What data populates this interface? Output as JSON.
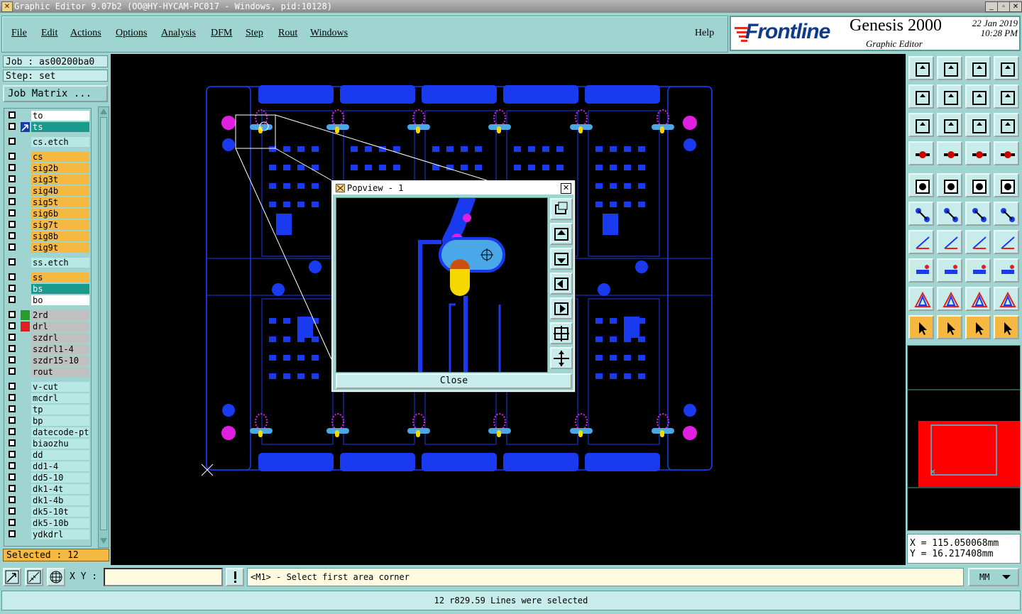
{
  "window": {
    "title": "Graphic Editor 9.07b2 (OO@HY-HYCAM-PC017 - Windows, pid:10128)"
  },
  "menu": [
    "File",
    "Edit",
    "Actions",
    "Options",
    "Analysis",
    "DFM",
    "Step",
    "Rout",
    "Windows"
  ],
  "help_label": "Help",
  "brand": {
    "logo": "Frontline",
    "product": "Genesis 2000",
    "subtitle": "Graphic Editor",
    "date": "22 Jan 2019",
    "time": "10:28 PM"
  },
  "job": {
    "job_label": "Job : as00200ba0",
    "step_label": "Step: set",
    "matrix_button": "Job Matrix ..."
  },
  "layers": [
    {
      "name": "to",
      "bg": "#ffffff",
      "swatch": ""
    },
    {
      "name": "ts",
      "bg": "#1a9a8c",
      "swatch": "#1a3ab0",
      "active": true
    },
    {
      "name": "cs.etch",
      "bg": "#b8e8e4",
      "swatch": "",
      "gap": true
    },
    {
      "name": "cs",
      "bg": "#f5b840",
      "swatch": "",
      "gap": true
    },
    {
      "name": "sig2b",
      "bg": "#f5b840",
      "swatch": ""
    },
    {
      "name": "sig3t",
      "bg": "#f5b840",
      "swatch": ""
    },
    {
      "name": "sig4b",
      "bg": "#f5b840",
      "swatch": ""
    },
    {
      "name": "sig5t",
      "bg": "#f5b840",
      "swatch": ""
    },
    {
      "name": "sig6b",
      "bg": "#f5b840",
      "swatch": ""
    },
    {
      "name": "sig7t",
      "bg": "#f5b840",
      "swatch": ""
    },
    {
      "name": "sig8b",
      "bg": "#f5b840",
      "swatch": ""
    },
    {
      "name": "sig9t",
      "bg": "#f5b840",
      "swatch": ""
    },
    {
      "name": "ss.etch",
      "bg": "#b8e8e4",
      "swatch": "",
      "gap": true
    },
    {
      "name": "ss",
      "bg": "#f5b840",
      "swatch": "",
      "gap": true
    },
    {
      "name": "bs",
      "bg": "#1a9a8c",
      "swatch": ""
    },
    {
      "name": "bo",
      "bg": "#ffffff",
      "swatch": ""
    },
    {
      "name": "2rd",
      "bg": "#c0c0c0",
      "swatch": "#2a9a2a",
      "gap": true
    },
    {
      "name": "drl",
      "bg": "#c0c0c0",
      "swatch": "#e02020"
    },
    {
      "name": "szdrl",
      "bg": "#c0c0c0",
      "swatch": ""
    },
    {
      "name": "szdrl1-4",
      "bg": "#c0c0c0",
      "swatch": ""
    },
    {
      "name": "szdr15-10",
      "bg": "#c0c0c0",
      "swatch": ""
    },
    {
      "name": "rout",
      "bg": "#c0c0c0",
      "swatch": ""
    },
    {
      "name": "v-cut",
      "bg": "#b8e8e4",
      "swatch": "",
      "gap": true
    },
    {
      "name": "mcdrl",
      "bg": "#b8e8e4",
      "swatch": ""
    },
    {
      "name": "tp",
      "bg": "#b8e8e4",
      "swatch": ""
    },
    {
      "name": "bp",
      "bg": "#b8e8e4",
      "swatch": ""
    },
    {
      "name": "datecode-ptc",
      "bg": "#b8e8e4",
      "swatch": ""
    },
    {
      "name": "biaozhu",
      "bg": "#b8e8e4",
      "swatch": ""
    },
    {
      "name": "dd",
      "bg": "#b8e8e4",
      "swatch": ""
    },
    {
      "name": "dd1-4",
      "bg": "#b8e8e4",
      "swatch": ""
    },
    {
      "name": "dd5-10",
      "bg": "#b8e8e4",
      "swatch": ""
    },
    {
      "name": "dk1-4t",
      "bg": "#b8e8e4",
      "swatch": ""
    },
    {
      "name": "dk1-4b",
      "bg": "#b8e8e4",
      "swatch": ""
    },
    {
      "name": "dk5-10t",
      "bg": "#b8e8e4",
      "swatch": ""
    },
    {
      "name": "dk5-10b",
      "bg": "#b8e8e4",
      "swatch": ""
    },
    {
      "name": "ydkdrl",
      "bg": "#b8e8e4",
      "swatch": ""
    }
  ],
  "selected_label": "Selected : 12",
  "popview": {
    "title": "Popview - 1",
    "close_label": "Close"
  },
  "coords": {
    "x": "X = 115.050068mm",
    "y": "Y = 16.217408mm"
  },
  "status": {
    "xy_label": "X Y :",
    "xy_value": "",
    "prompt": "<M1> - Select first area corner",
    "units": "MM",
    "message": "12 r829.59 Lines were selected"
  }
}
